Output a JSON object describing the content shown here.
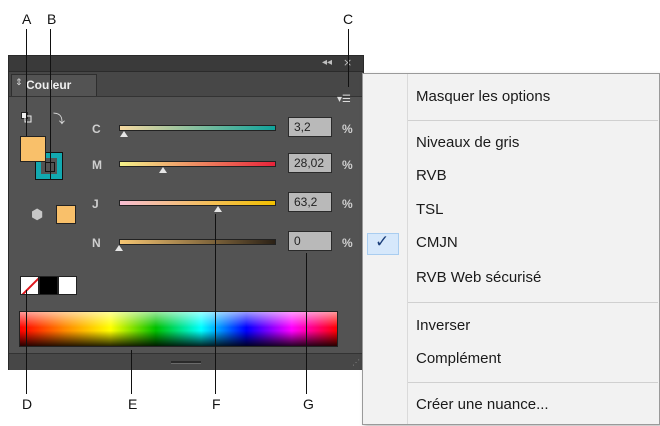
{
  "callouts": {
    "top": [
      "A",
      "B",
      "C"
    ],
    "bottom": [
      "D",
      "E",
      "F",
      "G"
    ]
  },
  "panel": {
    "tab_label": "Couleur",
    "tab_arrows": "⇕",
    "collapse_glyph": "◂◂",
    "close_glyph": "×",
    "menu_button_glyph": "▾☰",
    "swap_glyph": "⤵",
    "gamut_glyph": "⬢",
    "sliders": [
      {
        "label": "C",
        "value": "3,2",
        "pos": 0.03,
        "gradient": [
          "#f7d9a0",
          "#0fa39b"
        ]
      },
      {
        "label": "M",
        "value": "28,02",
        "pos": 0.28,
        "gradient": [
          "#f4f28a",
          "#e8233a"
        ]
      },
      {
        "label": "J",
        "value": "63,2",
        "pos": 0.63,
        "gradient": [
          "#f6bdd2",
          "#f2c000"
        ]
      },
      {
        "label": "N",
        "value": "0",
        "pos": 0.0,
        "gradient": [
          "#f7c672",
          "#2b2116"
        ]
      }
    ],
    "percent_sign": "%",
    "fill_color": "#f9c06a",
    "stroke_color": "#12a9b0"
  },
  "menu": {
    "items": [
      "Masquer les options",
      "Niveaux de gris",
      "RVB",
      "TSL",
      "CMJN",
      "RVB Web sécurisé",
      "Inverser",
      "Complément",
      "Créer une nuance..."
    ],
    "checked_item": "CMJN",
    "check_glyph": "✓"
  }
}
